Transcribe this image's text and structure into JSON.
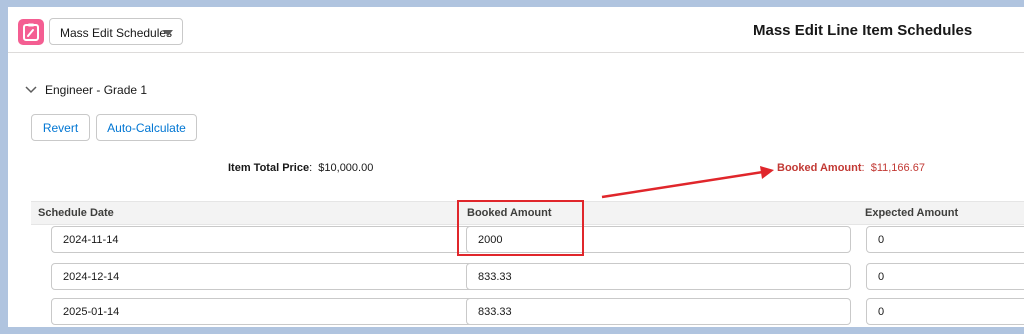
{
  "header": {
    "list_view_label": "Mass Edit Schedules",
    "title": "Mass Edit Line Item Schedules"
  },
  "section": {
    "title": "Engineer - Grade 1",
    "buttons": {
      "revert": "Revert",
      "auto_calculate": "Auto-Calculate"
    },
    "totals": {
      "item_total_label": "Item Total Price",
      "item_total_value": "$10,000.00",
      "booked_label": "Booked Amount",
      "booked_value": "$11,166.67"
    }
  },
  "table": {
    "columns": [
      "Schedule Date",
      "Booked Amount",
      "Expected Amount"
    ],
    "rows": [
      {
        "date": "2024-11-14",
        "booked": "2000",
        "expected": "0"
      },
      {
        "date": "2024-12-14",
        "booked": "833.33",
        "expected": "0"
      },
      {
        "date": "2025-01-14",
        "booked": "833.33",
        "expected": "0"
      }
    ]
  },
  "colors": {
    "app_icon": "#f45e92",
    "link_blue": "#0176d3",
    "error_red": "#c23934",
    "annotation_red": "#e0262b"
  },
  "icons": {
    "app": "clipboard-icon",
    "dropdown": "chevron-down-icon",
    "section_toggle": "chevron-down-icon"
  }
}
